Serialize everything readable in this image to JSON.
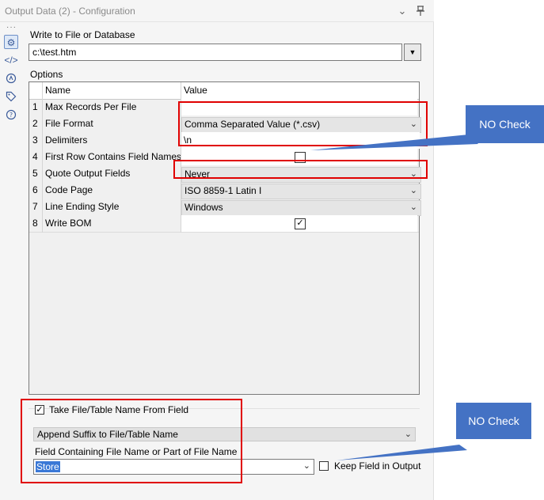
{
  "window": {
    "title": "Output Data (2) - Configuration"
  },
  "icons": {
    "dropdown": "chevron-down-icon",
    "pin": "pin-icon",
    "settings": "gear-icon",
    "xml": "code-icon",
    "annotation": "annotation-icon",
    "tag": "tag-icon",
    "help": "help-icon"
  },
  "write_to": {
    "label": "Write to File or Database",
    "value": "c:\\test.htm"
  },
  "options": {
    "label": "Options",
    "col_name": "Name",
    "col_value": "Value",
    "rows": [
      {
        "num": "1",
        "name": "Max Records Per File",
        "value": ""
      },
      {
        "num": "2",
        "name": "File Format",
        "value": "Comma Separated Value (*.csv)"
      },
      {
        "num": "3",
        "name": "Delimiters",
        "value": "\\n"
      },
      {
        "num": "4",
        "name": "First Row Contains Field Names",
        "value": ""
      },
      {
        "num": "5",
        "name": "Quote Output Fields",
        "value": "Never"
      },
      {
        "num": "6",
        "name": "Code Page",
        "value": "ISO 8859-1 Latin I"
      },
      {
        "num": "7",
        "name": "Line Ending Style",
        "value": "Windows"
      },
      {
        "num": "8",
        "name": "Write BOM",
        "value": ""
      }
    ]
  },
  "lower": {
    "take_name_label": "Take File/Table Name From Field",
    "take_name_checked": true,
    "mode_value": "Append Suffix to File/Table Name",
    "field_label": "Field Containing File Name or Part of File Name",
    "field_value": "Store",
    "keep_field_label": "Keep Field in Output",
    "keep_field_checked": false
  },
  "annotations": {
    "callout_1": "NO Check",
    "callout_2": "NO Check",
    "box_color": "#e00000",
    "callout_color": "#4472c4"
  }
}
